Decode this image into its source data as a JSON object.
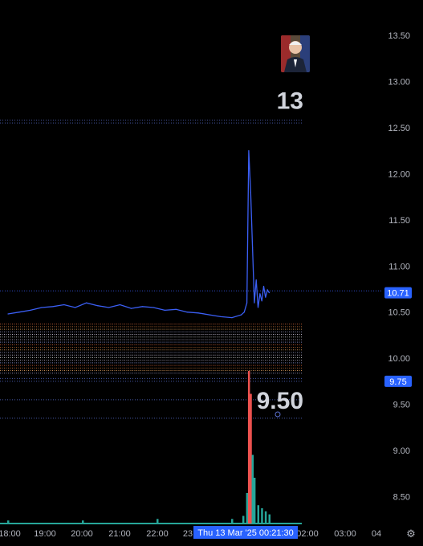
{
  "chart_data": {
    "type": "line",
    "y_ticks": [
      "13.50",
      "13.00",
      "12.50",
      "12.00",
      "11.50",
      "11.00",
      "10.50",
      "10.00",
      "9.50",
      "9.00",
      "8.50"
    ],
    "x_ticks": [
      "18:00",
      "19:00",
      "20:00",
      "21:00",
      "22:00",
      "23",
      "02:00",
      "03:00",
      "04"
    ],
    "ylim": [
      8.2,
      13.7
    ],
    "last_price": "10.71",
    "level_tag": "9.75",
    "crosshair_label": "Thu 13 Mar '25   00:21:30",
    "big_labels": [
      {
        "text": "13",
        "y": 12.8
      },
      {
        "text": "9.50",
        "y": 9.55
      }
    ],
    "level_lines": [
      12.55,
      12.58,
      10.73,
      9.75,
      9.78,
      9.55,
      9.35
    ],
    "band": {
      "from": 9.82,
      "to": 10.37
    },
    "series": [
      {
        "x": [
          18.0,
          18.3,
          18.6,
          18.9,
          19.2,
          19.5,
          19.8,
          20.1,
          20.4,
          20.7,
          21.0,
          21.3,
          21.6,
          21.9,
          22.2,
          22.5,
          22.8,
          23.1,
          23.4,
          23.7,
          24.0,
          24.25,
          24.33,
          24.4,
          24.45,
          24.5,
          24.55,
          24.6,
          24.65,
          24.7,
          24.75,
          24.8,
          24.85,
          24.9,
          24.95,
          25.0
        ],
        "values": [
          10.48,
          10.5,
          10.52,
          10.55,
          10.56,
          10.58,
          10.55,
          10.6,
          10.57,
          10.55,
          10.58,
          10.54,
          10.56,
          10.55,
          10.52,
          10.53,
          10.5,
          10.49,
          10.47,
          10.45,
          10.44,
          10.47,
          10.5,
          10.6,
          12.25,
          11.8,
          11.2,
          10.6,
          10.85,
          10.55,
          10.7,
          10.62,
          10.78,
          10.66,
          10.74,
          10.71
        ]
      }
    ],
    "volume": {
      "x": [
        18.0,
        20.0,
        22.0,
        24.0,
        24.3,
        24.4,
        24.45,
        24.5,
        24.55,
        24.6,
        24.7,
        24.8,
        24.9,
        25.0
      ],
      "values": [
        0.02,
        0.02,
        0.03,
        0.03,
        0.05,
        0.2,
        1.0,
        0.85,
        0.45,
        0.3,
        0.12,
        0.1,
        0.08,
        0.06
      ]
    }
  },
  "colors": {
    "line": "#3b5ff5",
    "tag": "#2962ff",
    "volume": "#26a69a",
    "volume_spike": "#ef5350"
  },
  "settings_icon": "gear-icon",
  "avatar_icon": "portrait-avatar"
}
